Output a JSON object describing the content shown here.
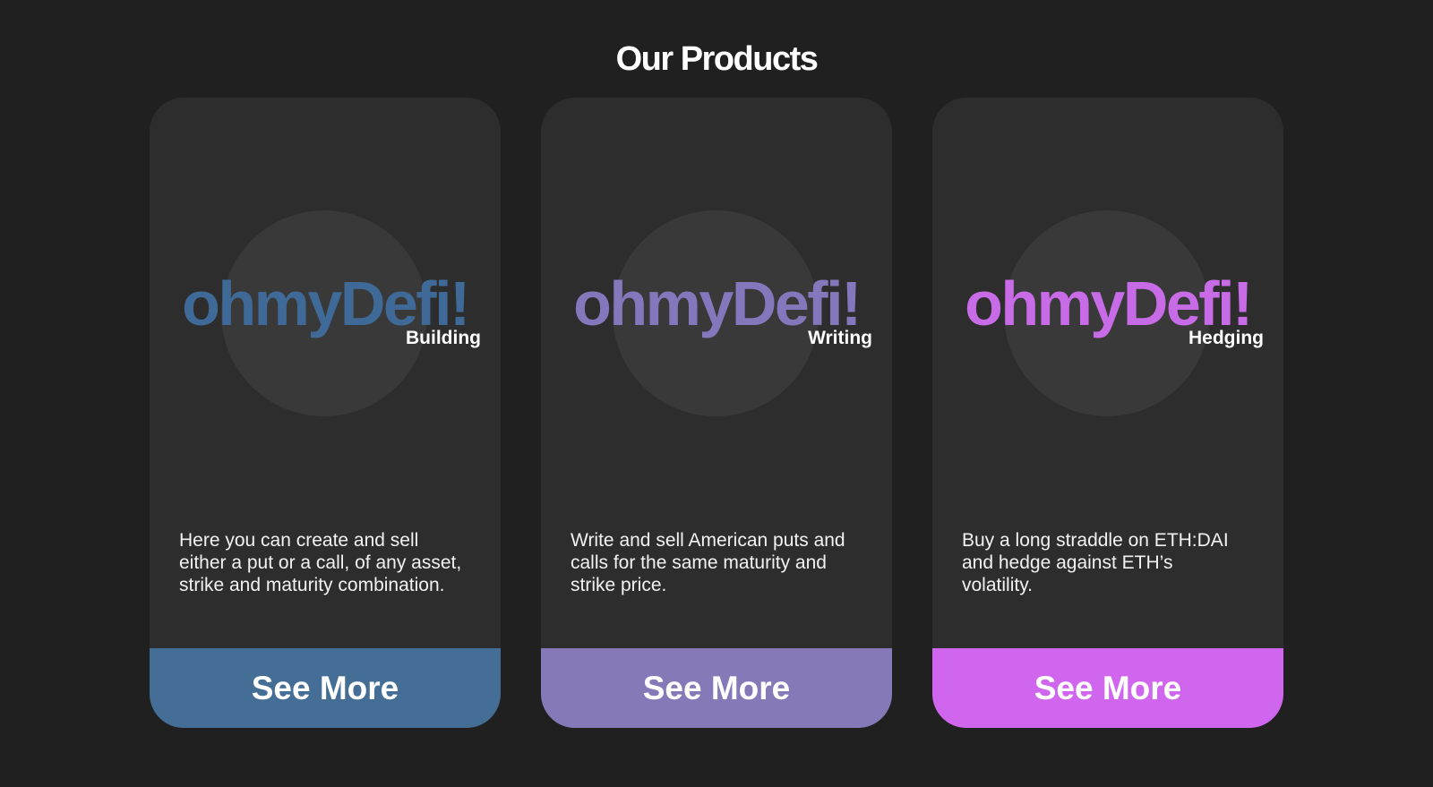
{
  "section": {
    "title": "Our Products"
  },
  "products": [
    {
      "logo_word": "ohmyDefi!",
      "logo_sub": "Building",
      "description": "Here you can create and sell either a put or a call, of any asset, strike and maturity combination.",
      "button_label": "See More",
      "accent_color": "#3f6a97",
      "button_color": "#456e96"
    },
    {
      "logo_word": "ohmyDefi!",
      "logo_sub": "Writing",
      "description": "Write and sell American puts and calls for the same maturity and strike price.",
      "button_label": "See More",
      "accent_color": "#8577bb",
      "button_color": "#857ab7"
    },
    {
      "logo_word": "ohmyDefi!",
      "logo_sub": "Hedging",
      "description": "Buy a long straddle on ETH:DAI and hedge against ETH’s volatility.",
      "button_label": "See More",
      "accent_color": "#c76be6",
      "button_color": "#d066ee"
    }
  ],
  "colors": {
    "background": "#202020",
    "card_background": "#2d2d2d",
    "logo_circle": "#393939"
  }
}
